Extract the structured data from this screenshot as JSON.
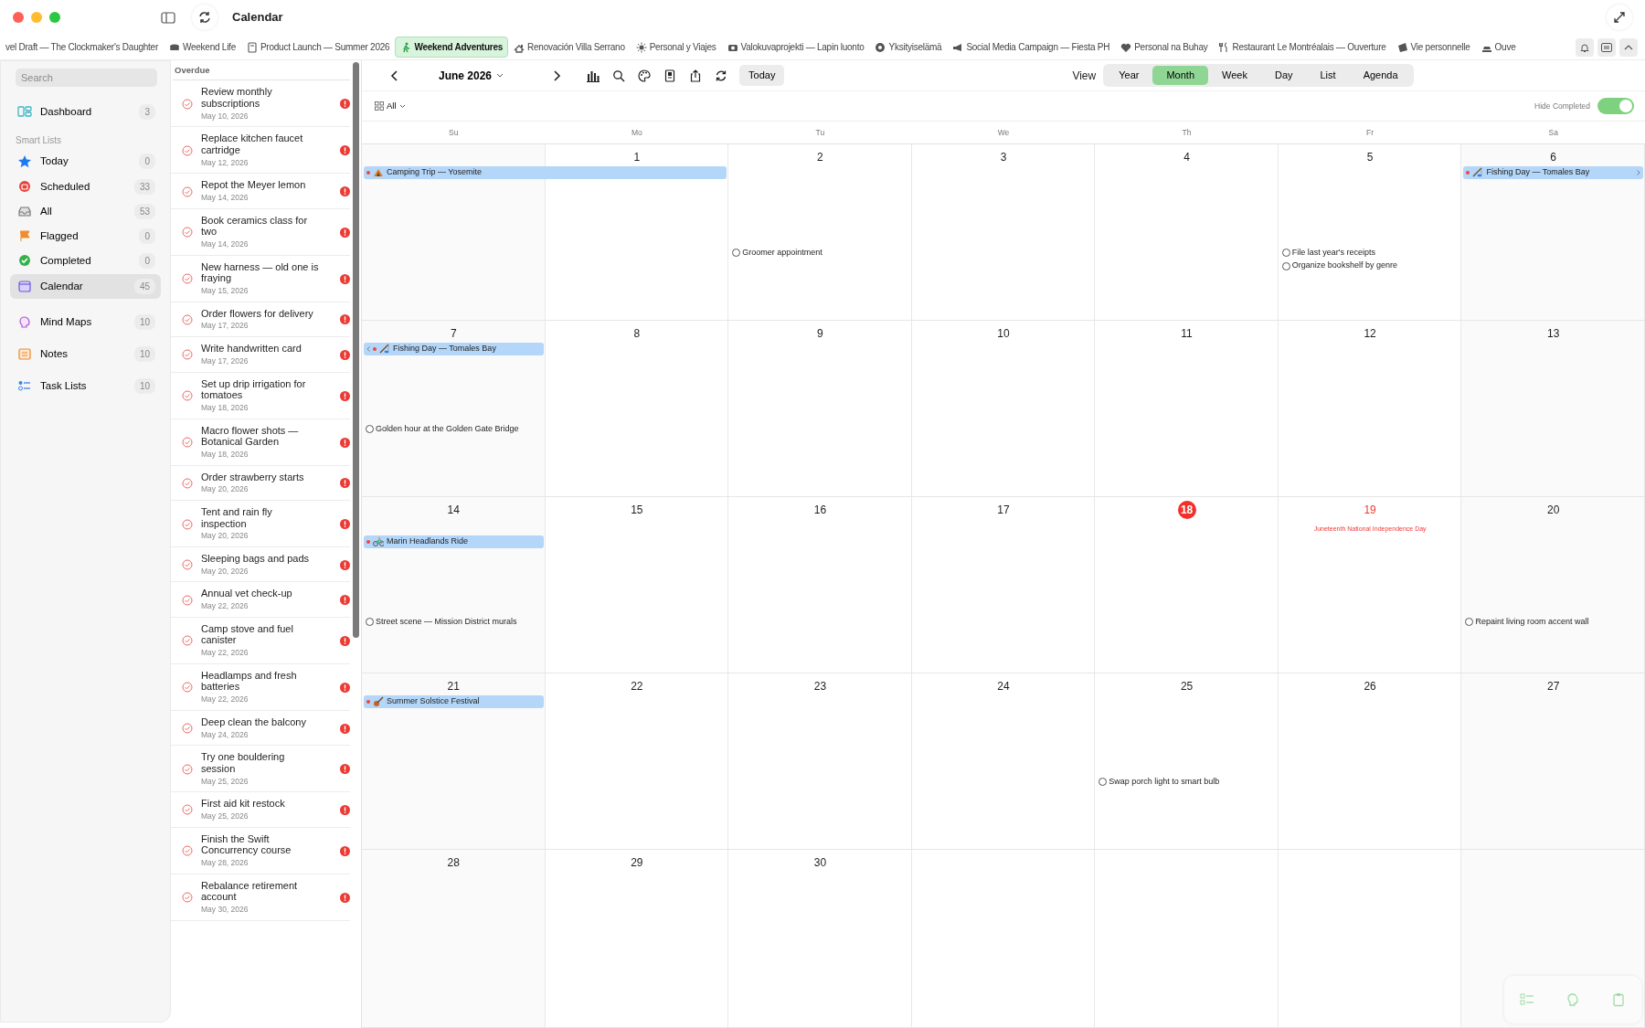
{
  "window": {
    "title": "Calendar"
  },
  "tabs": [
    {
      "label": "vel Draft — The Clockmaker's Daughter",
      "selected": false
    },
    {
      "label": "Weekend Life",
      "selected": false
    },
    {
      "label": "Product Launch — Summer 2026",
      "selected": false
    },
    {
      "label": "Weekend Adventures",
      "selected": true
    },
    {
      "label": "Renovación Villa Serrano",
      "selected": false
    },
    {
      "label": "Personal y Viajes",
      "selected": false
    },
    {
      "label": "Valokuvaprojekti — Lapin luonto",
      "selected": false
    },
    {
      "label": "Yksityiselämä",
      "selected": false
    },
    {
      "label": "Social Media Campaign — Fiesta PH",
      "selected": false
    },
    {
      "label": "Personal na Buhay",
      "selected": false
    },
    {
      "label": "Restaurant Le Montréalais — Ouverture",
      "selected": false
    },
    {
      "label": "Vie personnelle",
      "selected": false
    },
    {
      "label": "Ouve",
      "selected": false
    }
  ],
  "sidebar": {
    "search": {
      "placeholder": "Search"
    },
    "items": [
      {
        "label": "Dashboard",
        "count": "3",
        "selected": false
      }
    ],
    "section": {
      "title": "Smart Lists",
      "items": [
        {
          "label": "Today",
          "count": "0",
          "selected": false
        },
        {
          "label": "Scheduled",
          "count": "33",
          "selected": false
        },
        {
          "label": "All",
          "count": "53",
          "selected": false
        },
        {
          "label": "Flagged",
          "count": "0",
          "selected": false
        },
        {
          "label": "Completed",
          "count": "0",
          "selected": false
        },
        {
          "label": "Calendar",
          "count": "45",
          "selected": true
        }
      ]
    },
    "more_items": [
      {
        "label": "Mind Maps",
        "count": "10",
        "selected": false
      },
      {
        "label": "Notes",
        "count": "10",
        "selected": false
      },
      {
        "label": "Task Lists",
        "count": "10",
        "selected": false
      }
    ]
  },
  "overdue": {
    "title": "Overdue",
    "items": [
      {
        "title": "Review monthly subscriptions",
        "date": "May 10, 2026"
      },
      {
        "title": "Replace kitchen faucet cartridge",
        "date": "May 12, 2026"
      },
      {
        "title": "Repot the Meyer lemon",
        "date": "May 14, 2026"
      },
      {
        "title": "Book ceramics class for two",
        "date": "May 14, 2026"
      },
      {
        "title": "New harness — old one is fraying",
        "date": "May 15, 2026"
      },
      {
        "title": "Order flowers for delivery",
        "date": "May 17, 2026"
      },
      {
        "title": "Write handwritten card",
        "date": "May 17, 2026"
      },
      {
        "title": "Set up drip irrigation for tomatoes",
        "date": "May 18, 2026"
      },
      {
        "title": "Macro flower shots — Botanical Garden",
        "date": "May 18, 2026"
      },
      {
        "title": "Order strawberry starts",
        "date": "May 20, 2026"
      },
      {
        "title": "Tent and rain fly inspection",
        "date": "May 20, 2026"
      },
      {
        "title": "Sleeping bags and pads",
        "date": "May 20, 2026"
      },
      {
        "title": "Annual vet check-up",
        "date": "May 22, 2026"
      },
      {
        "title": "Camp stove and fuel canister",
        "date": "May 22, 2026"
      },
      {
        "title": "Headlamps and fresh batteries",
        "date": "May 22, 2026"
      },
      {
        "title": "Deep clean the balcony",
        "date": "May 24, 2026"
      },
      {
        "title": "Try one bouldering session",
        "date": "May 25, 2026"
      },
      {
        "title": "First aid kit restock",
        "date": "May 25, 2026"
      },
      {
        "title": "Finish the Swift Concurrency course",
        "date": "May 28, 2026"
      },
      {
        "title": "Rebalance retirement account",
        "date": "May 30, 2026"
      }
    ]
  },
  "toolbar": {
    "month": "June 2026",
    "today": "Today",
    "view_label": "View",
    "views": [
      {
        "label": "Year",
        "selected": false
      },
      {
        "label": "Month",
        "selected": true
      },
      {
        "label": "Week",
        "selected": false
      },
      {
        "label": "Day",
        "selected": false
      },
      {
        "label": "List",
        "selected": false
      },
      {
        "label": "Agenda",
        "selected": false
      }
    ]
  },
  "filter": {
    "label": "All",
    "hide_completed": {
      "label": "Hide Completed",
      "on": true
    }
  },
  "calendar": {
    "weekdays": [
      "Su",
      "Mo",
      "Tu",
      "We",
      "Th",
      "Fr",
      "Sa"
    ],
    "weeks": [
      {
        "days": [
          {
            "items": [
              {
                "kind": "event",
                "title": "Camping Trip — Yosemite",
                "continues": true
              }
            ]
          },
          {
            "date": "1",
            "today": false,
            "items": [
              {
                "kind": "event-end"
              }
            ]
          },
          {
            "date": "2",
            "today": false,
            "items": [
              {
                "kind": "task",
                "title": "Groomer appointment",
                "checked": false
              }
            ]
          },
          {
            "date": "3",
            "today": false
          },
          {
            "date": "4",
            "today": false
          },
          {
            "date": "5",
            "today": false,
            "items": [
              {
                "kind": "task",
                "title": "File last year's receipts",
                "checked": false
              },
              {
                "kind": "task",
                "title": "Organize bookshelf by genre",
                "checked": false
              }
            ]
          },
          {
            "date": "6",
            "today": false,
            "items": [
              {
                "kind": "event",
                "title": "Fishing Day — Tomales Bay",
                "continues": true
              }
            ]
          }
        ]
      },
      {
        "days": [
          {
            "date": "7",
            "today": false,
            "items": [
              {
                "kind": "event",
                "title": "Fishing Day — Tomales Bay",
                "continued": true
              },
              {
                "kind": "task",
                "title": "Golden hour at the Golden Gate Bridge",
                "checked": false
              }
            ]
          },
          {
            "date": "8",
            "today": false
          },
          {
            "date": "9",
            "today": false
          },
          {
            "date": "10",
            "today": false
          },
          {
            "date": "11",
            "today": false
          },
          {
            "date": "12",
            "today": false
          },
          {
            "date": "13",
            "today": false
          }
        ]
      },
      {
        "days": [
          {
            "date": "14",
            "today": false,
            "items": [
              {
                "kind": "event",
                "title": "Marin Headlands Ride"
              },
              {
                "kind": "task",
                "title": "Street scene — Mission District murals",
                "checked": false
              }
            ]
          },
          {
            "date": "15",
            "today": false
          },
          {
            "date": "16",
            "today": false
          },
          {
            "date": "17",
            "today": false
          },
          {
            "date": "18",
            "today": true
          },
          {
            "date": "19",
            "today": false,
            "items": [
              {
                "kind": "holiday",
                "title": "Juneteenth National Independence Day"
              }
            ]
          },
          {
            "date": "20",
            "today": false,
            "items": [
              {
                "kind": "task",
                "title": "Repaint living room accent wall",
                "checked": false
              }
            ]
          }
        ]
      },
      {
        "days": [
          {
            "date": "21",
            "today": false,
            "items": [
              {
                "kind": "event",
                "title": "Summer Solstice Festival"
              }
            ]
          },
          {
            "date": "22",
            "today": false
          },
          {
            "date": "23",
            "today": false
          },
          {
            "date": "24",
            "today": false
          },
          {
            "date": "25",
            "today": false,
            "items": [
              {
                "kind": "task",
                "title": "Swap porch light to smart bulb",
                "checked": false
              }
            ]
          },
          {
            "date": "26",
            "today": false
          },
          {
            "date": "27",
            "today": false
          }
        ]
      },
      {
        "days": [
          {
            "date": "28",
            "today": false
          },
          {
            "date": "29",
            "today": false
          },
          {
            "date": "30",
            "today": false
          }
        ]
      }
    ]
  }
}
